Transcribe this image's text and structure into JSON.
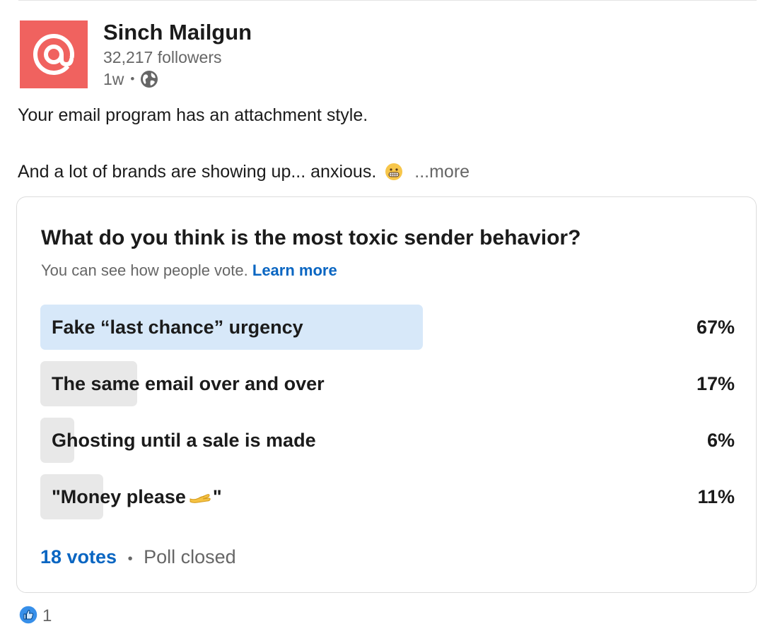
{
  "post": {
    "author_name": "Sinch Mailgun",
    "followers": "32,217 followers",
    "time_ago": "1w",
    "separator": "•",
    "text_line1": "Your email program has an attachment style.",
    "text_line2": "And a lot of brands are showing up... anxious.",
    "more_label": "...more",
    "icons": {
      "avatar": "mailgun-at-logo",
      "visibility": "globe-icon",
      "emoji": "grimacing-face-emoji"
    }
  },
  "poll": {
    "question": "What do you think is the most toxic sender behavior?",
    "subtitle": "You can see how people vote.",
    "learn_more": "Learn more",
    "options": [
      {
        "label": "Fake “last chance” urgency",
        "percent": "67%",
        "value": 67,
        "selected": true
      },
      {
        "label": "The same email over and over",
        "percent": "17%",
        "value": 17,
        "selected": false
      },
      {
        "label": "Ghosting until a sale is made",
        "percent": "6%",
        "value": 6,
        "selected": false
      },
      {
        "label_before": "\"Money please",
        "label_after": "\"",
        "percent": "11%",
        "value": 11,
        "selected": false,
        "icon": "palm-up-hand-emoji"
      }
    ],
    "votes": "18 votes",
    "separator": "•",
    "status": "Poll closed"
  },
  "reactions": {
    "icon": "like-thumbs-up-icon",
    "count": "1"
  },
  "colors": {
    "brand": "#f0625f",
    "link": "#0a66c2",
    "selected_bar": "#d7e8f9",
    "bar": "#e8e8e8",
    "muted_text": "#666666"
  }
}
